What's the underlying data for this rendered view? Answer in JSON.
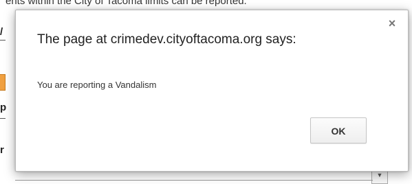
{
  "background_page": {
    "notice_text": "ents within the City of Tacoma limits can be reported.",
    "left_glyphs": [
      "/",
      "p",
      "r"
    ]
  },
  "dialog": {
    "title": "The page at crimedev.cityoftacoma.org says:",
    "close_glyph": "×",
    "message": "You are reporting a Vandalism",
    "ok_label": "OK"
  },
  "colors": {
    "dialog_background": "#ffffff",
    "orange_chip": "#f0a040"
  }
}
